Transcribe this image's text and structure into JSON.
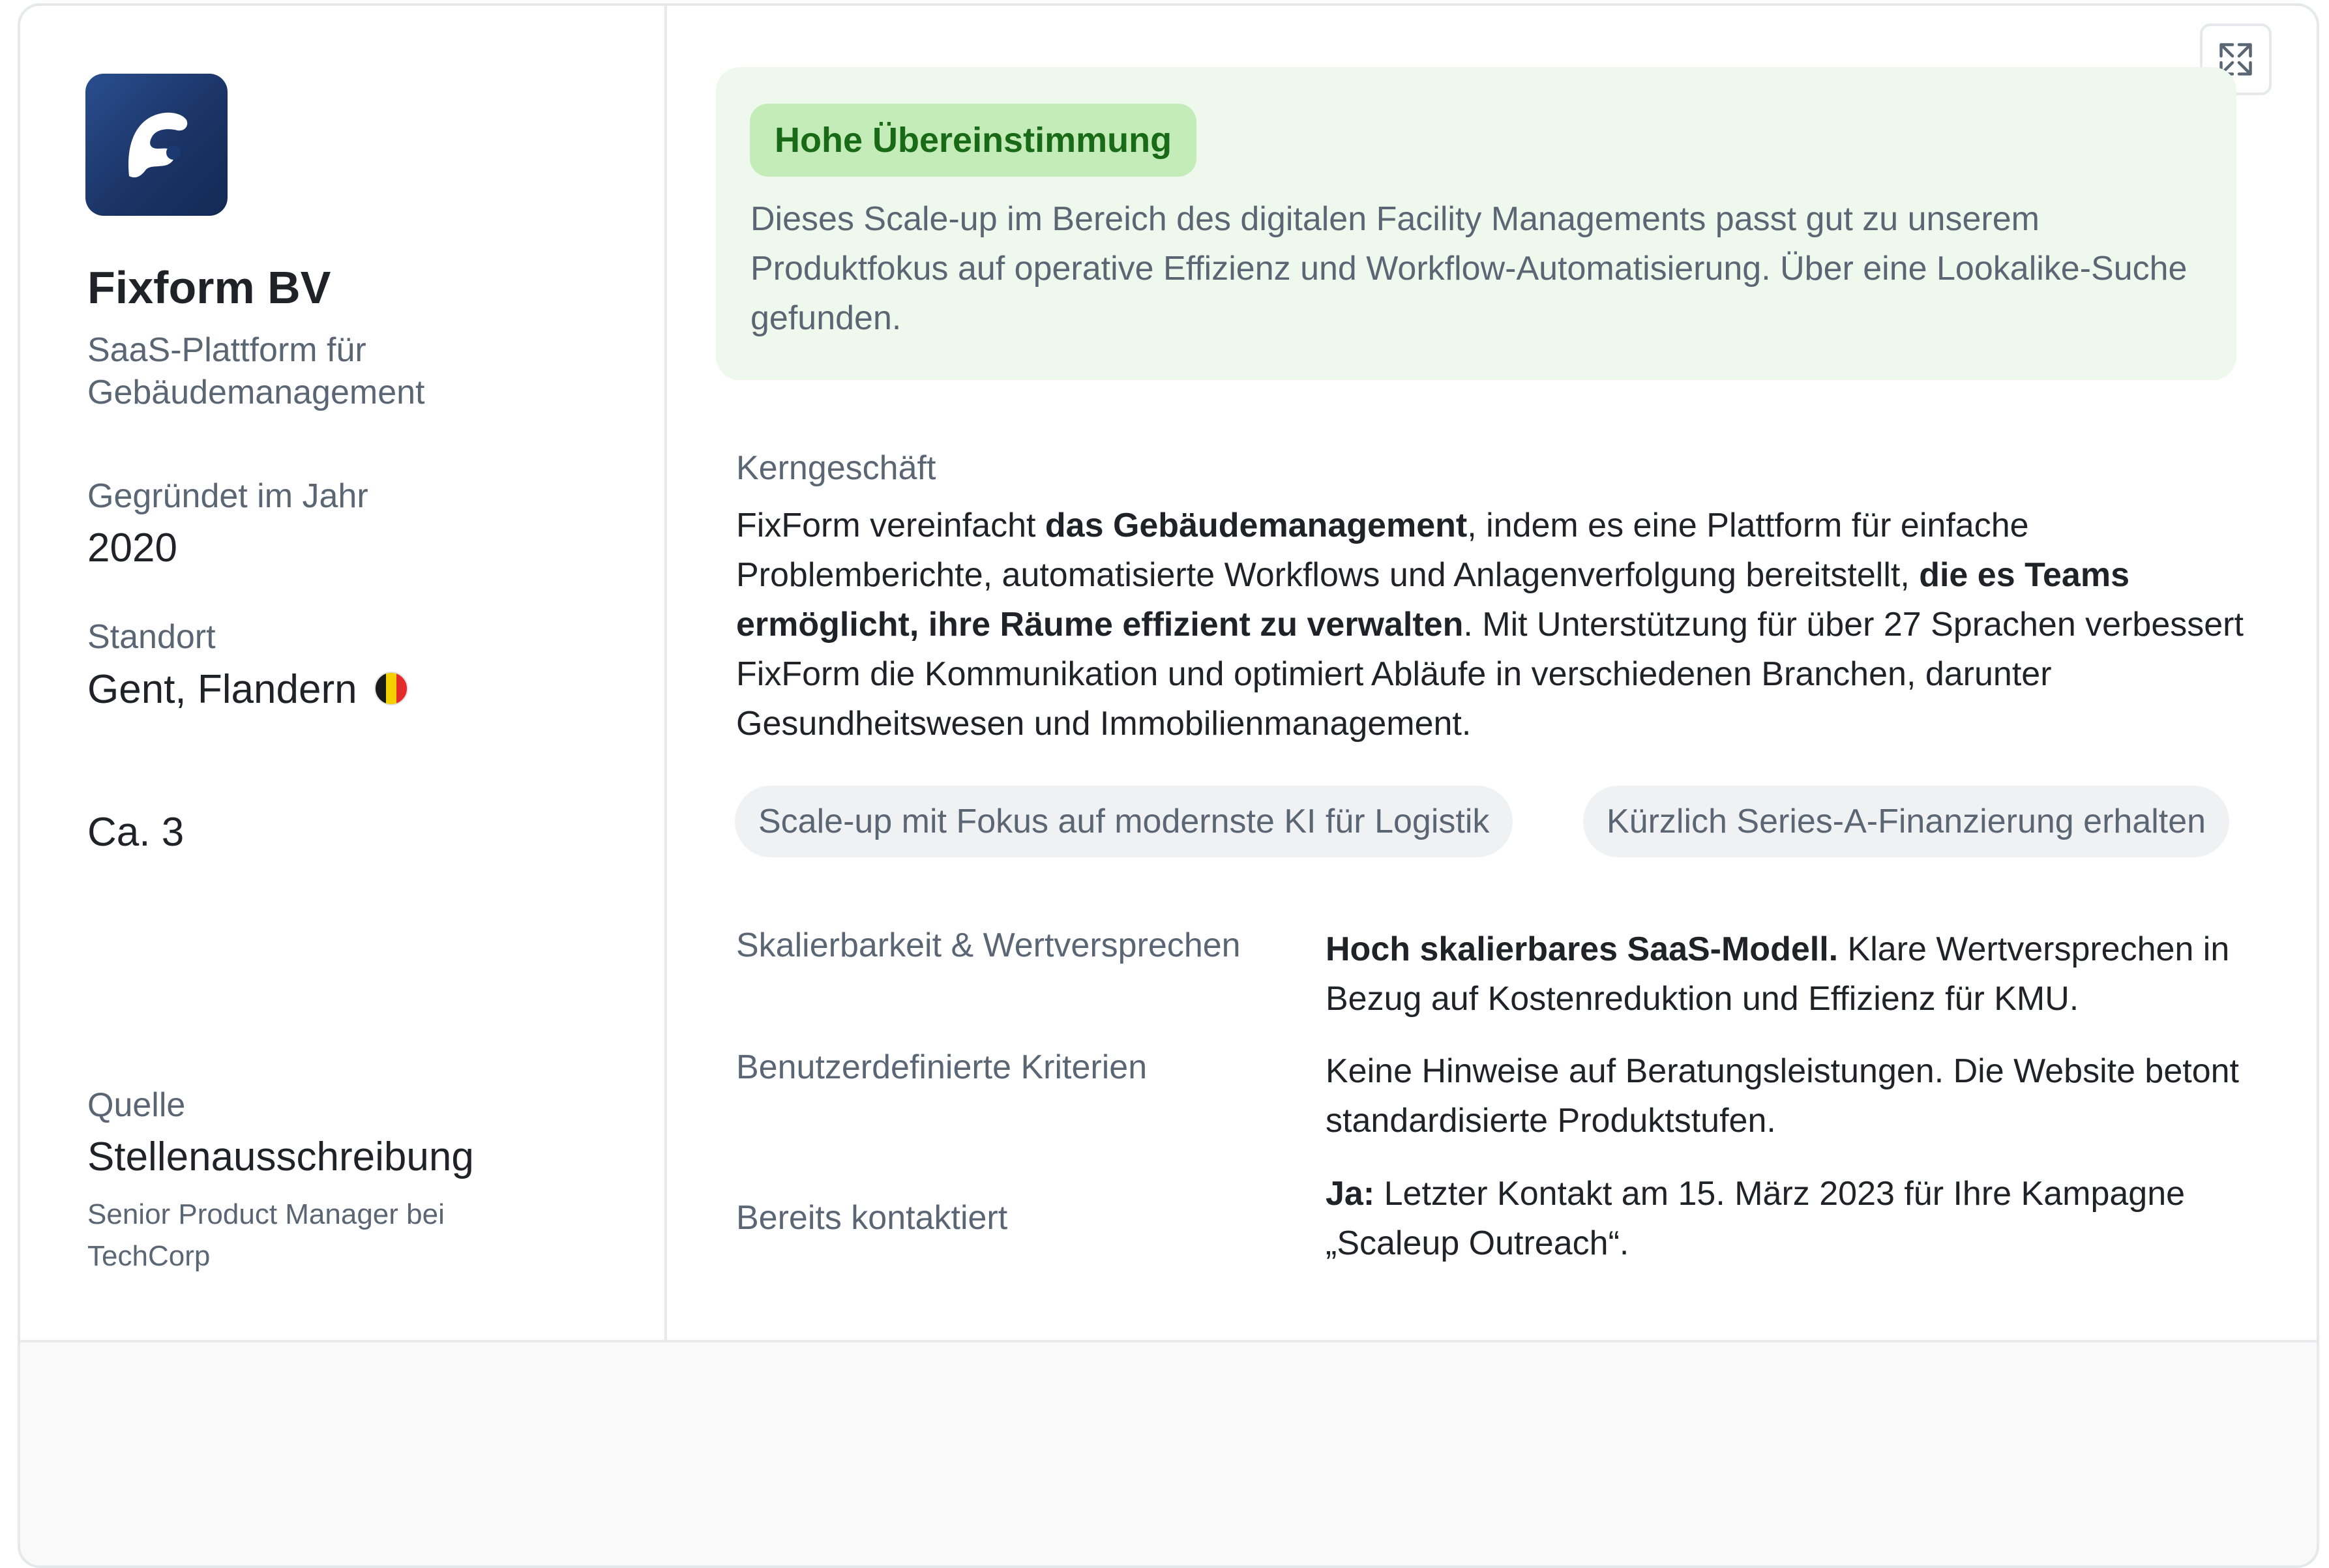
{
  "company": {
    "name": "Fixform BV",
    "tagline": "SaaS-Plattform für Gebäudemanagement",
    "founded_label": "Gegründet im Jahr",
    "founded_value": "2020",
    "location_label": "Standort",
    "location_value": "Gent, Flandern",
    "location_flag_icon": "belgium-flag-icon",
    "employees_value": "Ca. 3",
    "source_label": "Quelle",
    "source_value": "Stellenausschreibung",
    "source_detail": "Senior Product Manager bei TechCorp"
  },
  "match": {
    "badge": "Hohe Übereinstimmung",
    "badge_color": "#196a16",
    "badge_bg": "#c4ecb8",
    "description": "Dieses Scale-up im Bereich des digitalen Facility Managements passt gut zu unserem Produktfokus auf operative Effizienz und Workflow-Automatisierung. Über eine Lookalike-Suche gefunden."
  },
  "core_business": {
    "label": "Kerngeschäft",
    "text_1": "FixForm vereinfacht ",
    "text_1_bold": "das Gebäudemanagement",
    "text_2": ", indem es eine Plattform für einfache Problemberichte, automatisierte Workflows und Anlagenverfolgung bereitstellt, ",
    "text_2_bold": "die es Teams ermöglicht, ihre Räume effizient zu verwalten",
    "text_3": ". Mit Unterstützung für über 27 Sprachen verbessert FixForm die Kommunikation und optimiert Abläufe in verschiedenen Branchen, darunter Gesundheitswesen und Immobilienmanagement."
  },
  "tags": [
    "Scale-up mit Fokus auf modernste KI für Logistik",
    "Kürzlich Series-A-Finanzierung erhalten"
  ],
  "details": {
    "scalability_label": "Skalierbarkeit & Wertversprechen",
    "scalability_bold": "Hoch skalierbares SaaS-Modell.",
    "scalability_text": " Klare Wertversprechen in Bezug auf Kostenreduktion und Effizienz für KMU.",
    "criteria_label": "Benutzerdefinierte Kriterien",
    "criteria_text": "Keine Hinweise auf Beratungsleistungen. Die Website betont standardisierte Produktstufen.",
    "contacted_label": "Bereits kontaktiert",
    "contacted_bold": "Ja:",
    "contacted_text": " Letzter Kontakt am 15. März 2023 für Ihre Kampagne „Scaleup Outreach“."
  },
  "icons": {
    "logo": "fixform-logo-icon",
    "expand": "expand-icon"
  }
}
